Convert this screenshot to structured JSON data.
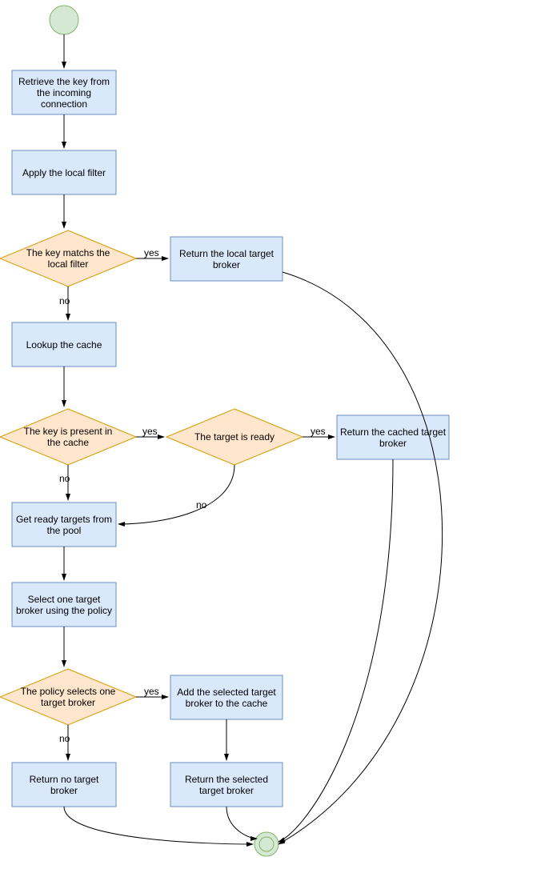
{
  "nodes": {
    "retrieve_key": "Retrieve the key from the incoming connection",
    "apply_filter": "Apply the local filter",
    "key_matches_filter": "The key matchs the local filter",
    "return_local": "Return the local target broker",
    "lookup_cache": "Lookup the cache",
    "key_in_cache": "The key is present in the cache",
    "target_ready": "The target is ready",
    "return_cached": "Return the cached target broker",
    "get_ready": "Get ready targets from the pool",
    "select_target": "Select one target broker using the policy",
    "policy_selects": "The policy selects one target broker",
    "add_to_cache": "Add the selected target broker to the cache",
    "return_no_target": "Return no target broker",
    "return_selected": "Return the selected target broker"
  },
  "edges": {
    "yes": "yes",
    "no": "no"
  },
  "colors": {
    "process_fill": "#dae8fc",
    "process_stroke": "#6c8ebf",
    "decision_fill": "#ffe6cc",
    "decision_stroke": "#d79b00",
    "terminator_fill": "#d5e8d4",
    "terminator_stroke": "#82b366"
  }
}
